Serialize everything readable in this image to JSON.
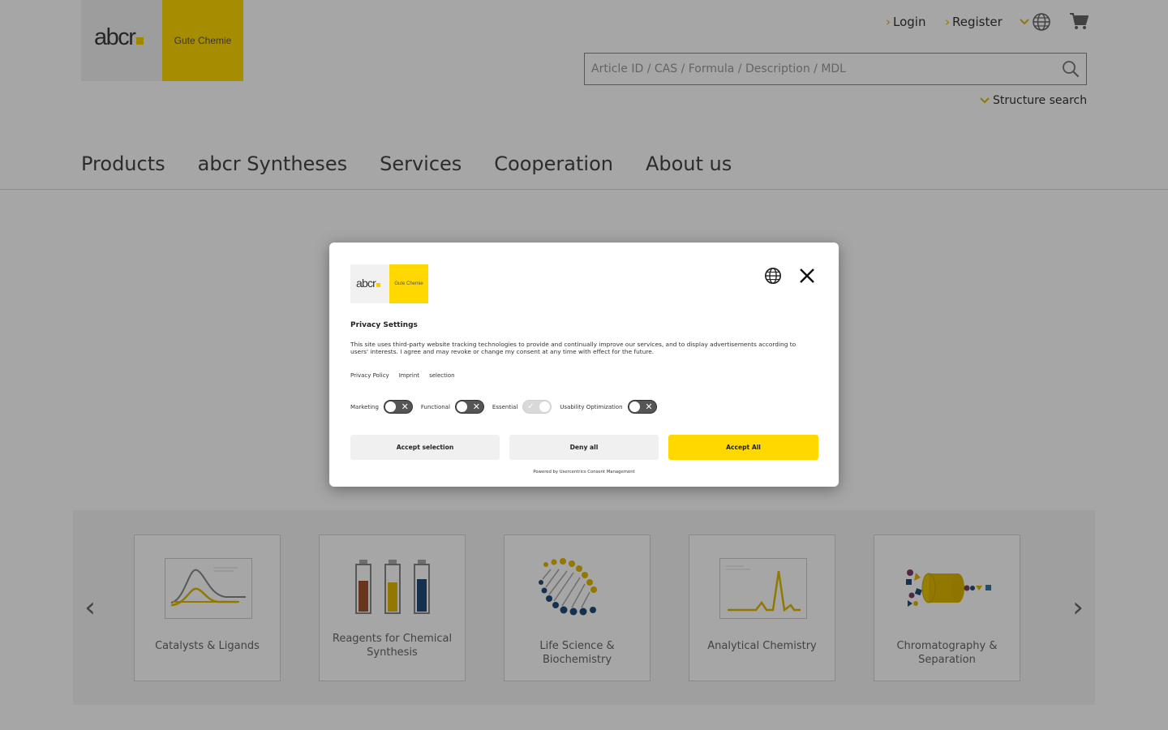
{
  "header": {
    "logo": {
      "word": "abcr",
      "tagline": "Gute Chemie"
    },
    "top_links": {
      "login": "Login",
      "register": "Register"
    },
    "search": {
      "placeholder": "Article ID / CAS / Formula / Description / MDL",
      "value": ""
    },
    "structure_search": "Structure search",
    "main_nav": [
      "Products",
      "abcr Syntheses",
      "Services",
      "Cooperation",
      "About us"
    ]
  },
  "carousel": {
    "cards": [
      {
        "label": "Catalysts & Ligands",
        "icon": "catalysts-chart-icon"
      },
      {
        "label": "Reagents for Chemical Synthesis",
        "icon": "reagent-bottles-icon"
      },
      {
        "label": "Life Science & Biochemistry",
        "icon": "dna-helix-icon"
      },
      {
        "label": "Analytical Chemistry",
        "icon": "spectrum-peak-icon"
      },
      {
        "label": "Chromatography & Separation",
        "icon": "chromatography-column-icon"
      }
    ]
  },
  "consent": {
    "logo": {
      "word": "abcr",
      "tagline": "Gute Chemie"
    },
    "title": "Privacy Settings",
    "text": "This site uses third-party website tracking technologies to provide and continually improve our services, and to display advertisements according to users' interests. I agree and may revoke or change my consent at any time with effect for the future.",
    "links": [
      "Privacy Policy",
      "Imprint",
      "selection"
    ],
    "toggles": [
      {
        "label": "Marketing",
        "state": "off"
      },
      {
        "label": "Functional",
        "state": "off"
      },
      {
        "label": "Essential",
        "state": "on-locked"
      },
      {
        "label": "Usability Optimization",
        "state": "off"
      }
    ],
    "buttons": {
      "accept_selection": "Accept selection",
      "deny": "Deny all",
      "accept_all": "Accept All"
    },
    "powered_by": "Powered by Usercentrics Consent Management"
  },
  "colors": {
    "brand_yellow": "#ffd800",
    "overlay": "rgba(0,0,0,0.35)"
  }
}
